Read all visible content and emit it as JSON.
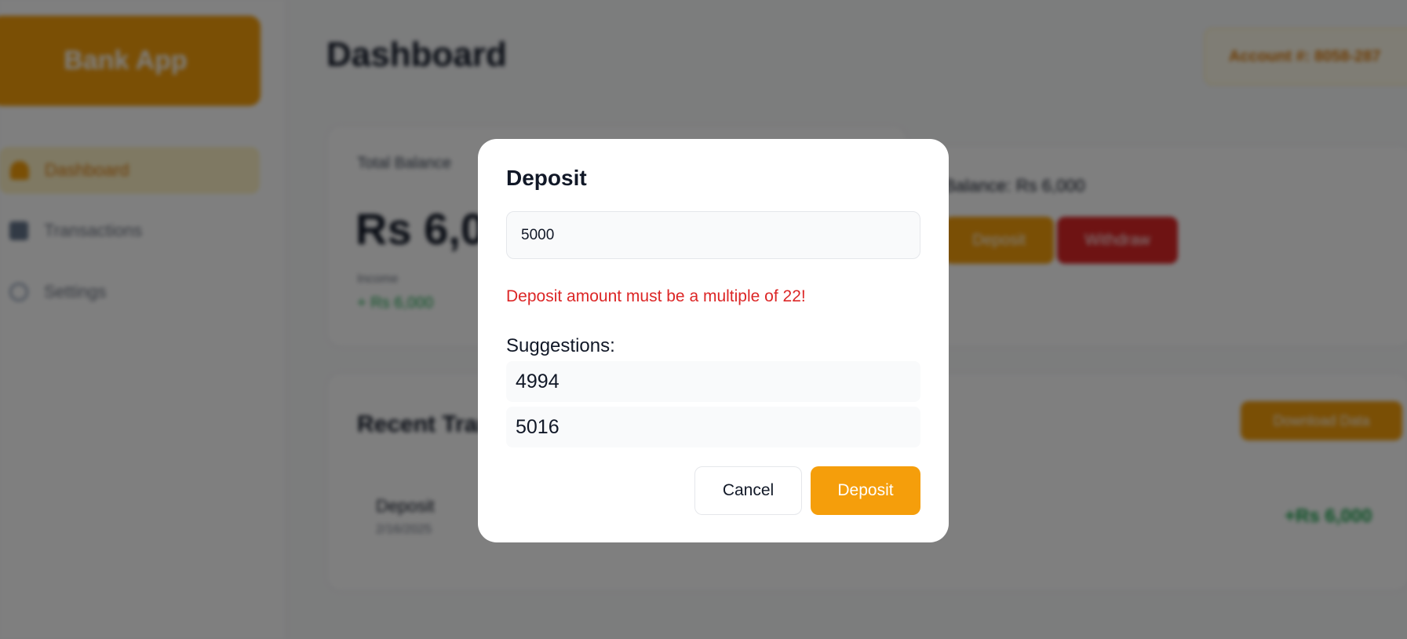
{
  "sidebar": {
    "logo": "Bank App",
    "items": [
      {
        "label": "Dashboard",
        "icon": "home-icon",
        "active": true
      },
      {
        "label": "Transactions",
        "icon": "list-icon",
        "active": false
      },
      {
        "label": "Settings",
        "icon": "gear-icon",
        "active": false
      }
    ]
  },
  "header": {
    "title": "Dashboard",
    "account": "Account #: 8058-287"
  },
  "balance_card": {
    "label": "Total Balance",
    "amount": "Rs 6,000",
    "income_label": "Income",
    "income_value": "+ Rs 6,000"
  },
  "actions_card": {
    "balance_text": "Balance: Rs 6,000",
    "deposit_label": "Deposit",
    "withdraw_label": "Withdraw"
  },
  "transactions": {
    "title": "Recent Transactions",
    "download_label": "Download Data",
    "rows": [
      {
        "type": "Deposit",
        "date": "2/16/2025",
        "amount": "+Rs 6,000"
      }
    ]
  },
  "modal": {
    "title": "Deposit",
    "amount_value": "5000",
    "error": "Deposit amount must be a multiple of 22!",
    "suggestions_label": "Suggestions:",
    "suggestions": [
      "4994",
      "5016"
    ],
    "cancel_label": "Cancel",
    "deposit_label": "Deposit"
  },
  "colors": {
    "accent": "#f59e0b",
    "error": "#dc2626",
    "success": "#16a34a"
  }
}
